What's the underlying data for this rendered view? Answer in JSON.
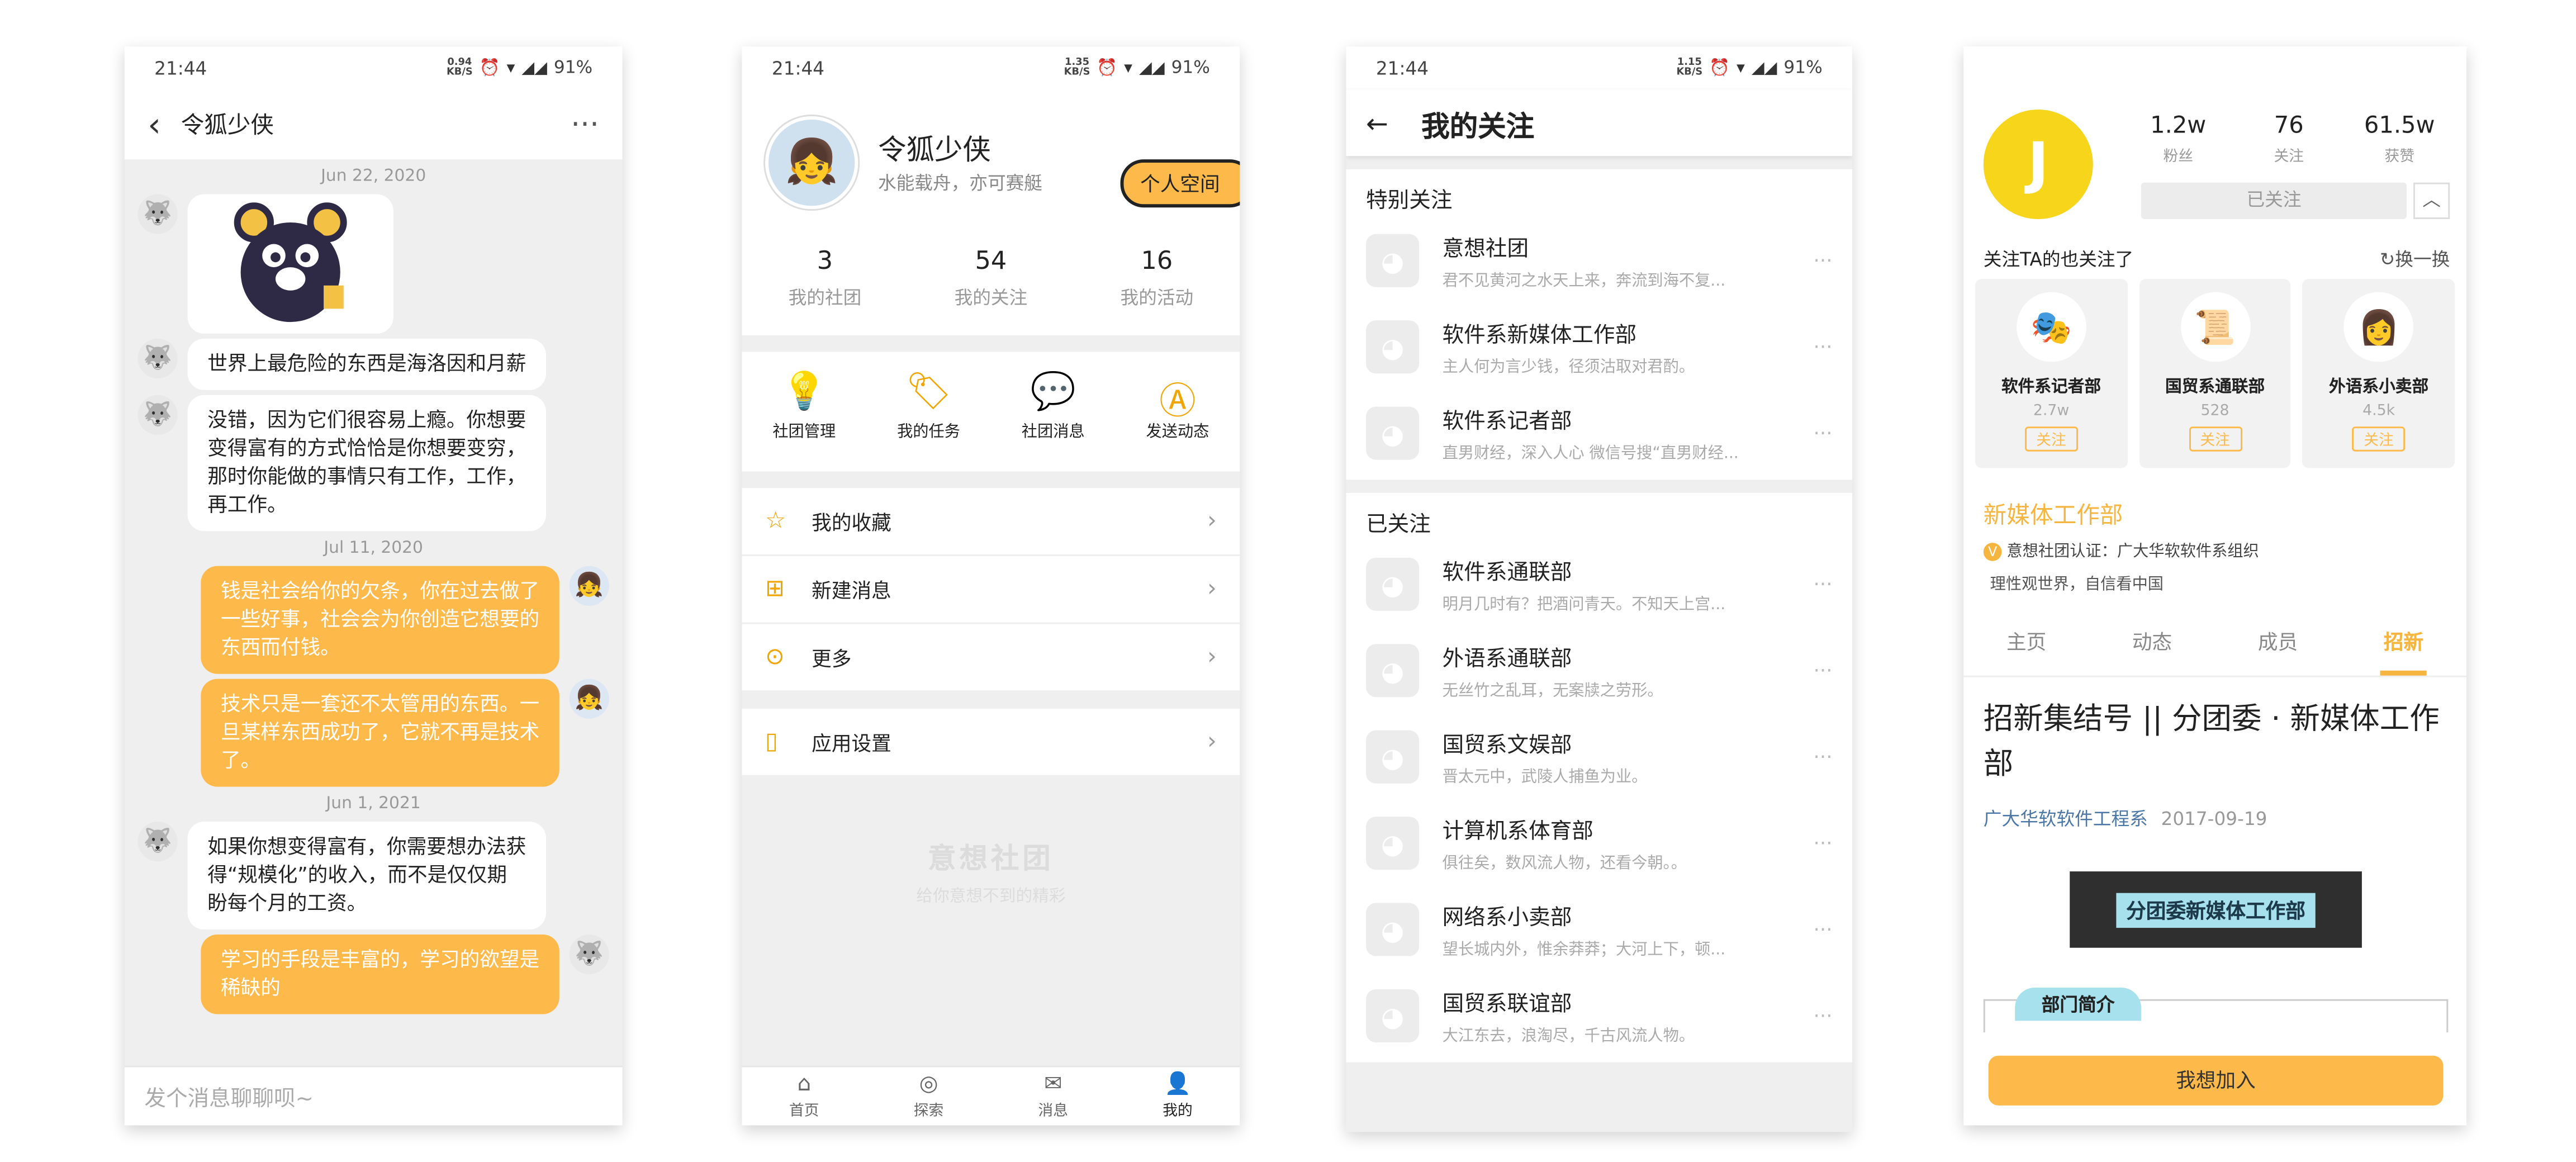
{
  "colors": {
    "accent": "#fdb94a",
    "bubble_right": "#fdb94a",
    "background": "#efefef",
    "link": "#4a77a6"
  },
  "chat": {
    "status": {
      "time": "21:44",
      "speed": "0.94",
      "speed_unit": "KB/S",
      "battery": "91%"
    },
    "title": "令狐少侠",
    "back_icon": "chevron-left-icon",
    "more_icon": "more-icon",
    "dates": [
      "Jun 22, 2020",
      "Jul 11, 2020",
      "Jun 1, 2021"
    ],
    "messages": [
      {
        "side": "left",
        "text": "世界上最危险的东西是海洛因和月薪"
      },
      {
        "side": "left",
        "text": "没错，因为它们很容易上瘾。你想要变得富有的方式恰恰是你想要变穷，那时你能做的事情只有工作，工作，再工作。"
      },
      {
        "side": "right",
        "text": "钱是社会给你的欠条，你在过去做了一些好事，社会会为你创造它想要的东西而付钱。"
      },
      {
        "side": "right",
        "text": "技术只是一套还不太管用的东西。一旦某样东西成功了，它就不再是技术了。"
      },
      {
        "side": "left",
        "text": "如果你想变得富有，你需要想办法获得“规模化”的收入，而不是仅仅期盼每个月的工资。"
      },
      {
        "side": "right",
        "text": "学习的手段是丰富的，学习的欲望是稀缺的"
      }
    ],
    "input_placeholder": "发个消息聊聊呗~"
  },
  "profile": {
    "status": {
      "time": "21:44",
      "speed": "1.35",
      "speed_unit": "KB/S",
      "battery": "91%"
    },
    "name": "令狐少侠",
    "signature": "水能载舟，亦可赛艇",
    "space_button": "个人空间",
    "stats": [
      {
        "value": "3",
        "label": "我的社团"
      },
      {
        "value": "54",
        "label": "我的关注"
      },
      {
        "value": "16",
        "label": "我的活动"
      }
    ],
    "grid": [
      {
        "icon": "bulb-icon",
        "label": "社团管理"
      },
      {
        "icon": "tag-icon",
        "label": "我的任务"
      },
      {
        "icon": "message-icon",
        "label": "社团消息"
      },
      {
        "icon": "send-icon",
        "label": "发送动态"
      }
    ],
    "menu": [
      {
        "icon": "star-icon",
        "label": "我的收藏"
      },
      {
        "icon": "plus-icon",
        "label": "新建消息"
      },
      {
        "icon": "more-circle-icon",
        "label": "更多"
      }
    ],
    "settings": {
      "icon": "phone-icon",
      "label": "应用设置"
    },
    "watermark": {
      "title": "意想社团",
      "subtitle": "给你意想不到的精彩"
    },
    "tabbar": [
      {
        "icon": "home-icon",
        "label": "首页"
      },
      {
        "icon": "explore-icon",
        "label": "探索"
      },
      {
        "icon": "mail-icon",
        "label": "消息"
      },
      {
        "icon": "user-icon",
        "label": "我的"
      }
    ]
  },
  "follows": {
    "status": {
      "time": "21:44",
      "speed": "1.15",
      "speed_unit": "KB/S",
      "battery": "91%"
    },
    "title": "我的关注",
    "special_title": "特别关注",
    "special": [
      {
        "name": "意想社团",
        "desc": "君不见黄河之水天上来，奔流到海不复..."
      },
      {
        "name": "软件系新媒体工作部",
        "desc": "主人何为言少钱，径须沽取对君酌。"
      },
      {
        "name": "软件系记者部",
        "desc": "直男财经，深入人心 微信号搜“直男财经..."
      }
    ],
    "followed_title": "已关注",
    "followed": [
      {
        "name": "软件系通联部",
        "desc": "明月几时有？把酒问青天。不知天上宫..."
      },
      {
        "name": "外语系通联部",
        "desc": "无丝竹之乱耳，无案牍之劳形。"
      },
      {
        "name": "国贸系文娱部",
        "desc": "晋太元中，武陵人捕鱼为业。"
      },
      {
        "name": "计算机系体育部",
        "desc": "俱往矣，数风流人物，还看今朝。。"
      },
      {
        "name": "网络系小卖部",
        "desc": "望长城内外，惟余莽莽；大河上下，顿..."
      },
      {
        "name": "国贸系联谊部",
        "desc": "大江东去，浪淘尽，千古风流人物。"
      }
    ]
  },
  "club": {
    "logo_letter": "J",
    "stats": [
      {
        "value": "1.2w",
        "label": "粉丝"
      },
      {
        "value": "76",
        "label": "关注"
      },
      {
        "value": "61.5w",
        "label": "获赞"
      }
    ],
    "followed_button": "已关注",
    "also_title": "关注TA的也关注了",
    "switch_label": "换一换",
    "cards": [
      {
        "name": "软件系记者部",
        "count": "2.7w",
        "button": "关注"
      },
      {
        "name": "国贸系通联部",
        "count": "528",
        "button": "关注"
      },
      {
        "name": "外语系小卖部",
        "count": "4.5k",
        "button": "关注"
      }
    ],
    "name": "新媒体工作部",
    "cert_badge": "V",
    "certification": "意想社团认证：广大华软软件系组织",
    "motto": "理性观世界，自信看中国",
    "tabs": [
      "主页",
      "动态",
      "成员",
      "招新"
    ],
    "article_title": "招新集结号 || 分团委 · 新媒体工作部",
    "article_author": "广大华软软件工程系",
    "article_date": "2017-09-19",
    "banner_text": "分团委新媒体工作部",
    "intro_label": "部门简介",
    "join_button": "我想加入"
  }
}
